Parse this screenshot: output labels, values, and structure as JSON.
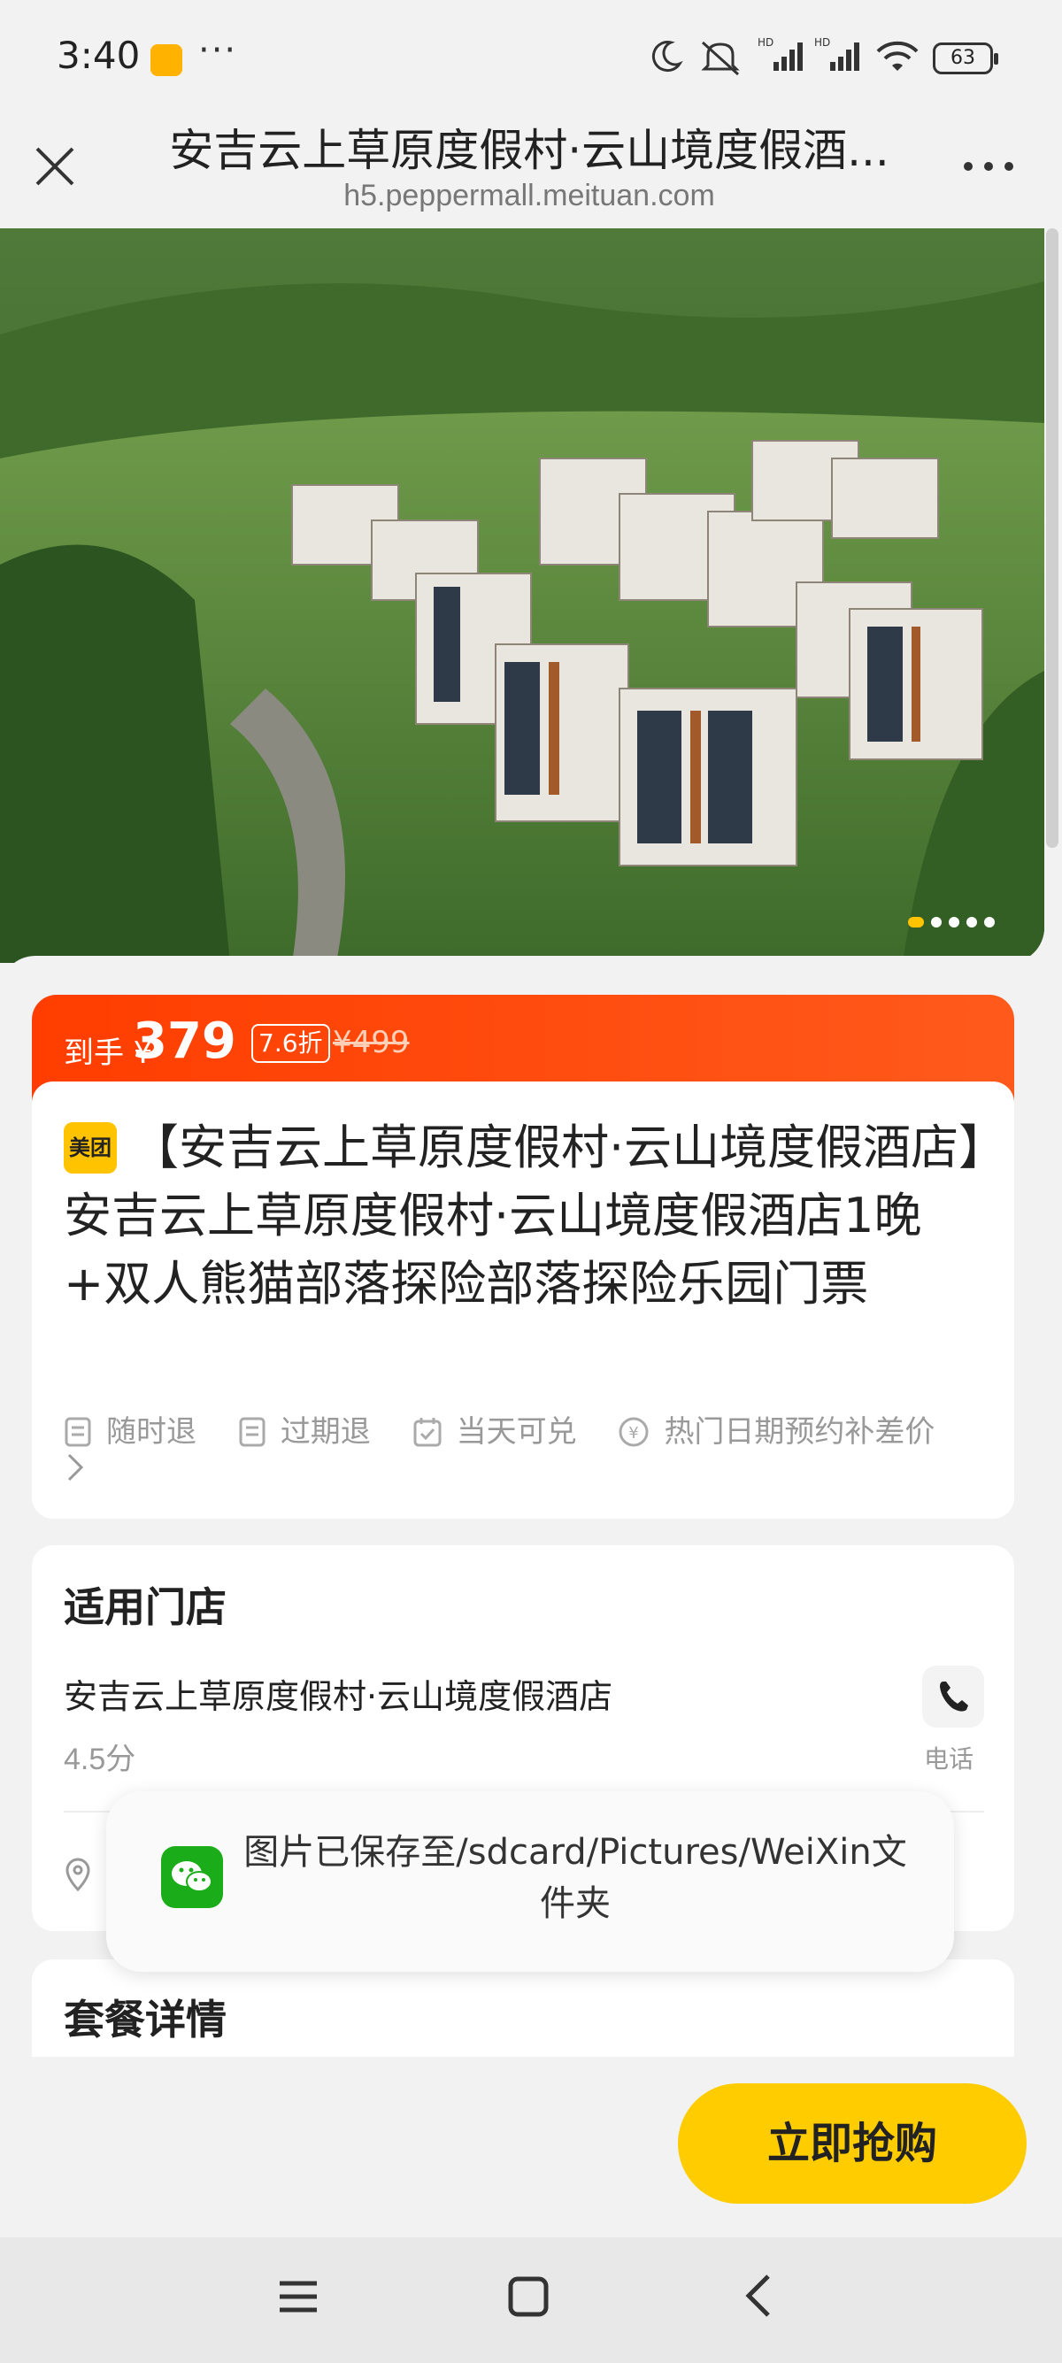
{
  "status_bar": {
    "time": "3:40",
    "dots": "···",
    "battery": "63",
    "icons": [
      "moon-icon",
      "mute-icon",
      "hd-signal-icon",
      "hd-signal-icon",
      "wifi-icon",
      "battery-icon"
    ]
  },
  "nav": {
    "title": "安吉云上草原度假村·云山境度假酒...",
    "url": "h5.peppermall.meituan.com"
  },
  "hero": {
    "slide_count": 5,
    "active_slide": 1
  },
  "price": {
    "prefix": "到手 ¥",
    "current": "379",
    "discount": "7.6折",
    "original": "¥499"
  },
  "product": {
    "badge": "美团",
    "title": "【安吉云上草原度假村·云山境度假酒店】安吉云上草原度假村·云山境度假酒店1晚+双人熊猫部落探险部落探险乐园门票",
    "tags": [
      "随时退",
      "过期退",
      "当天可兑",
      "热门日期预约补差价"
    ]
  },
  "store": {
    "heading": "适用门店",
    "name": "安吉云上草原度假村·云山境度假酒店",
    "score": "4.5分",
    "phone_label": "电话"
  },
  "package": {
    "heading": "套餐详情"
  },
  "toast": {
    "text": "图片已保存至/sdcard/Pictures/WeiXin文件夹"
  },
  "buy_button": {
    "label": "立即抢购"
  },
  "colors": {
    "accent_orange": "#ff4a10",
    "brand_yellow": "#ffc300",
    "wechat_green": "#1aad19"
  }
}
